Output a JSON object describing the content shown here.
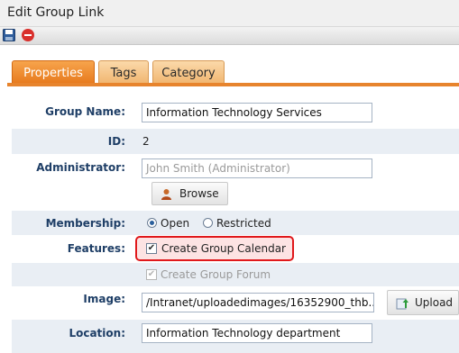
{
  "window": {
    "title": "Edit Group Link"
  },
  "toolbar": {
    "save_icon": "floppy-disk-icon",
    "delete_icon": "red-minus-circle-icon"
  },
  "tabs": [
    {
      "label": "Properties",
      "active": true
    },
    {
      "label": "Tags",
      "active": false
    },
    {
      "label": "Category",
      "active": false
    }
  ],
  "form": {
    "group_name": {
      "label": "Group Name:",
      "value": "Information Technology Services"
    },
    "id": {
      "label": "ID:",
      "value": "2"
    },
    "administrator": {
      "label": "Administrator:",
      "placeholder": "John Smith (Administrator)",
      "browse_label": "Browse"
    },
    "membership": {
      "label": "Membership:",
      "options": [
        "Open",
        "Restricted"
      ],
      "selected": "Open"
    },
    "features": {
      "label": "Features:",
      "create_calendar": {
        "label": "Create Group Calendar",
        "checked": true
      },
      "create_forum": {
        "label": "Create Group Forum",
        "checked": true,
        "disabled": true
      }
    },
    "image": {
      "label": "Image:",
      "value": "/Intranet/uploadedimages/16352900_thb...",
      "upload_label": "Upload"
    },
    "location": {
      "label": "Location:",
      "value": "Information Technology department"
    }
  },
  "colors": {
    "accent": "#e7842d",
    "highlight": "#e0181b",
    "label": "#1e3e66"
  }
}
